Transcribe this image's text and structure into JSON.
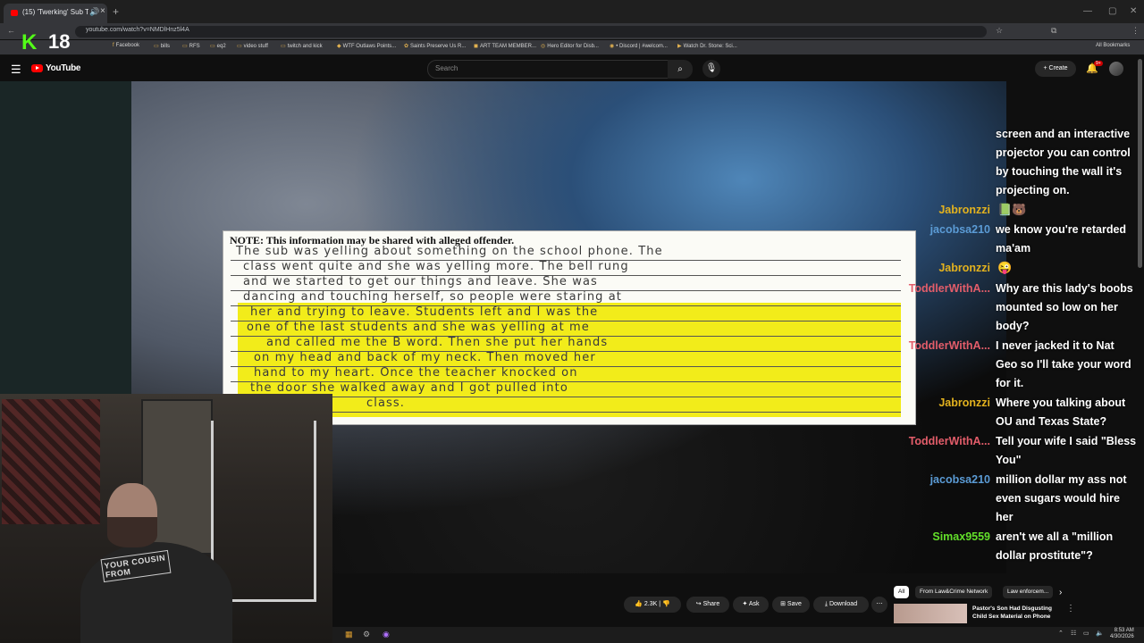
{
  "browser": {
    "tab_title": "(15) 'Twerking' Sub Teacher",
    "url": "youtube.com/watch?v=NMDlHnz5l4A",
    "bookmarks": [
      "Facebook",
      "bills",
      "RFS",
      "eq2",
      "video stuff",
      "twitch and kick",
      "WTF Outlaws Points...",
      "Saints Preserve Us R...",
      "ART TEAM MEMBER...",
      "Hero Editor for Disb...",
      "• Discord | #welcom...",
      "Watch Dr. Stone: Sci..."
    ],
    "all_bookmarks": "All Bookmarks",
    "kick_logo": "K",
    "kick_count": "18"
  },
  "youtube": {
    "brand": "YouTube",
    "search_placeholder": "Search",
    "create_label": "Create",
    "notif_badge": "9+"
  },
  "document": {
    "note": "NOTE: This information may be shared with alleged offender.",
    "lines": [
      "The sub was yelling about something on the school phone. The",
      "class went quite and she was yelling more. The bell rung",
      "and we started to get our things and leave. She was",
      "dancing and touching herself, so people were staring at",
      "her and trying to leave. Students left and I was the",
      "one of the last students and she was yelling at me",
      "and called me the B word. Then she put her hands",
      "on my head and back of my neck. Then moved her",
      "hand to my heart. Once the teacher knocked on",
      "the door she walked away and I got pulled into",
      "class."
    ]
  },
  "chat": [
    {
      "user": "",
      "text": "screen and an interactive projector you can control by touching the wall it's projecting on.",
      "color": "#ffffff"
    },
    {
      "user": "Jabronzzi",
      "text": "",
      "color": "#e3b21e",
      "emote": "📗🐻"
    },
    {
      "user": "jacobsa210",
      "text": "we know you're retarded ma'am",
      "color": "#5b9bd5"
    },
    {
      "user": "Jabronzzi",
      "text": "",
      "color": "#e3b21e",
      "emote": "😜"
    },
    {
      "user": "ToddlerWithA...",
      "text": "Why are this lady's boobs mounted so low on her body?",
      "color": "#e35d6a"
    },
    {
      "user": "ToddlerWithA...",
      "text": "I never jacked it to Nat Geo so I'll take your word for it.",
      "color": "#e35d6a"
    },
    {
      "user": "Jabronzzi",
      "text": "Where you talking about OU and Texas State?",
      "color": "#e3b21e"
    },
    {
      "user": "ToddlerWithA...",
      "text": "Tell your wife I said \"Bless You\"",
      "color": "#e35d6a"
    },
    {
      "user": "jacobsa210",
      "text": "million dollar my ass not even sugars would hire her",
      "color": "#5b9bd5"
    },
    {
      "user": "Simax9559",
      "text": "aren't we all a \"million dollar prostitute\"?",
      "color": "#63e02a"
    }
  ],
  "webcam": {
    "shirt_text": "YOUR COUSIN FROM"
  },
  "actions": {
    "likes": "2.3K",
    "share": "Share",
    "ask": "Ask",
    "save": "Save",
    "download": "Download"
  },
  "related": {
    "chips": [
      "All",
      "From Law&Crime Network",
      "Law enforcem..."
    ],
    "rec_title": "Pastor's Son Had Disgusting Child Sex Material on Phone"
  },
  "taskbar": {
    "time": "8:53 AM",
    "date": "4/30/2026"
  }
}
